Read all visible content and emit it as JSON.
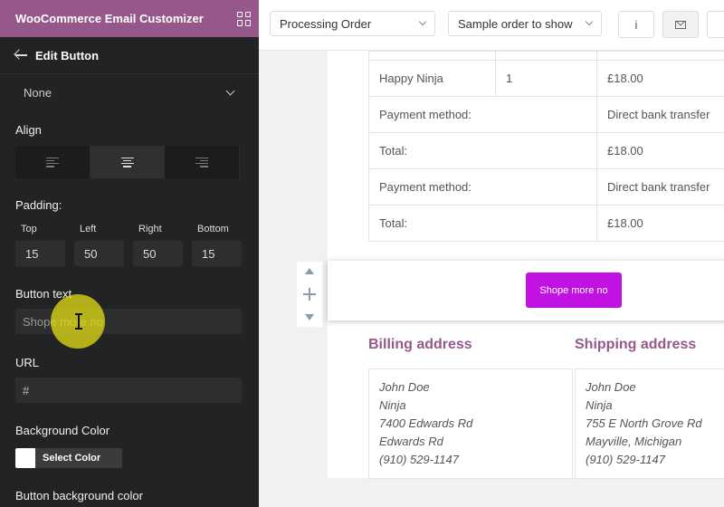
{
  "sidebar": {
    "app_title": "WooCommerce Email Customizer",
    "header_icon": "grid-icon",
    "back_icon": "arrow-left-icon",
    "section_title": "Edit Button",
    "select_value": "None",
    "align_label": "Align",
    "align_options": [
      "left",
      "center",
      "right"
    ],
    "align_selected": "center",
    "padding_label": "Padding:",
    "padding": [
      {
        "label": "Top",
        "value": "15"
      },
      {
        "label": "Left",
        "value": "50"
      },
      {
        "label": "Right",
        "value": "50"
      },
      {
        "label": "Bottom",
        "value": "15"
      }
    ],
    "button_text_label": "Button text",
    "button_text_value": "Shope more no",
    "url_label": "URL",
    "url_value": "#",
    "bg_color_label": "Background Color",
    "select_color_label": "Select Color",
    "swatch_color": "#ffffff",
    "button_bg_label": "Button background color"
  },
  "topbar": {
    "email_type": "Processing Order",
    "sample_order": "Sample order to show",
    "info_label": "i",
    "mail_icon": "mail-icon"
  },
  "order_table": {
    "product": {
      "name": "Happy Ninja",
      "qty": "1",
      "price": "£18.00"
    },
    "rows": [
      {
        "label": "Payment method:",
        "value": "Direct bank transfer"
      },
      {
        "label": "Total:",
        "value": "£18.00"
      },
      {
        "label": "Payment method:",
        "value": "Direct bank transfer"
      },
      {
        "label": "Total:",
        "value": "£18.00"
      }
    ]
  },
  "email_button": {
    "label": "Shope more no",
    "color": "#c012e0"
  },
  "billing": {
    "title": "Billing address",
    "lines": [
      "John Doe",
      "Ninja",
      "7400 Edwards Rd",
      "Edwards Rd",
      "(910) 529-1147"
    ]
  },
  "shipping": {
    "title": "Shipping address",
    "lines": [
      "John Doe",
      "Ninja",
      "755 E North Grove Rd",
      "Mayville, Michigan",
      "(910) 529-1147"
    ]
  },
  "brand_color": "#96588a"
}
